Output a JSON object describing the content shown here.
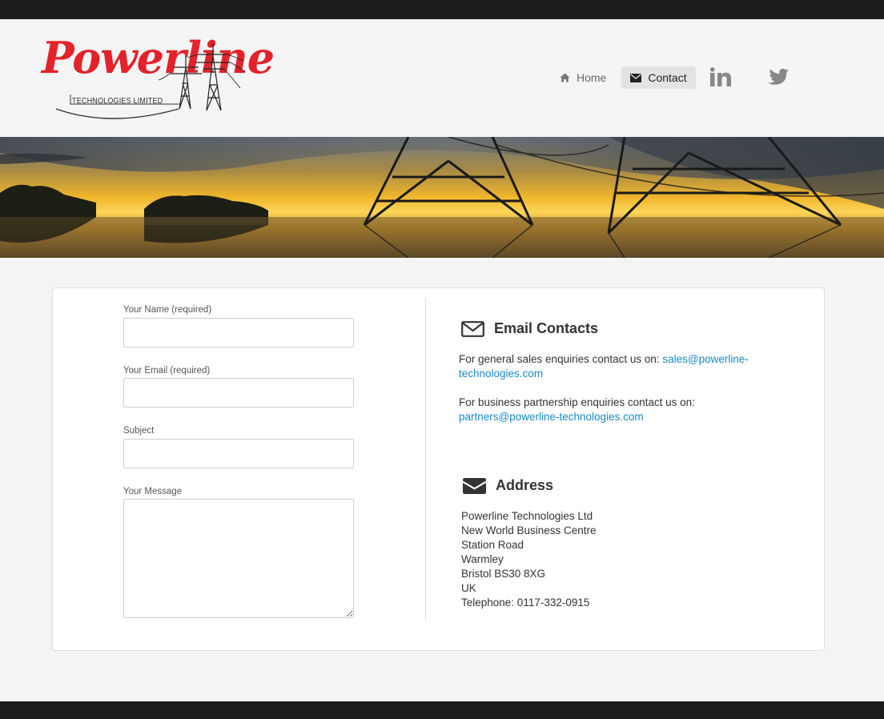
{
  "brand": {
    "logo_word": "Powerline",
    "logo_sub": "TECHNOLOGIES LIMITED"
  },
  "nav": {
    "items": [
      {
        "label": "Home",
        "icon": "home-icon",
        "active": false
      },
      {
        "label": "Contact",
        "icon": "envelope-icon",
        "active": true
      }
    ],
    "social": [
      {
        "icon": "linkedin-icon"
      },
      {
        "icon": "twitter-icon"
      }
    ]
  },
  "form": {
    "name_label": "Your Name (required)",
    "name_value": "",
    "email_label": "Your Email (required)",
    "email_value": "",
    "subject_label": "Subject",
    "subject_value": "",
    "message_label": "Your Message",
    "message_value": ""
  },
  "email_contacts": {
    "title": "Email Contacts",
    "sales_text": "For general sales enquiries contact us on: ",
    "sales_email": "sales@powerline-technologies.com",
    "partners_text": "For business partnership enquiries contact us on:",
    "partners_email": "partners@powerline-technologies.com"
  },
  "address": {
    "title": "Address",
    "lines": [
      "Powerline Technologies Ltd",
      "New World Business Centre",
      "Station Road",
      "Warmley",
      "Bristol BS30 8XG",
      "UK",
      "Telephone: 0117-332-0915"
    ]
  },
  "colors": {
    "accent_red": "#e3222a",
    "link_blue": "#1a88c9",
    "dark_bar": "#1b1c1e"
  }
}
